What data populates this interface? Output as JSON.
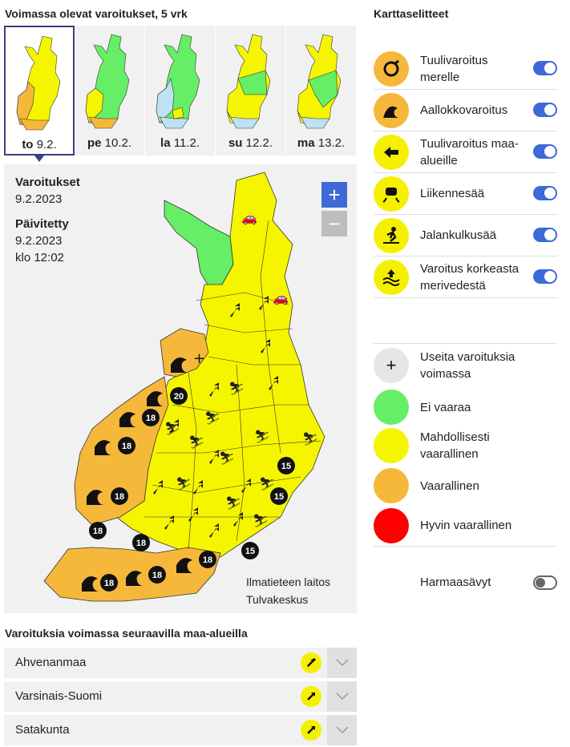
{
  "headings": {
    "days": "Voimassa olevat varoitukset, 5 vrk",
    "legend": "Karttaselitteet",
    "regions": "Varoituksia voimassa seuraavilla maa-alueilla"
  },
  "days": [
    {
      "weekday": "to",
      "date": "9.2.",
      "active": true
    },
    {
      "weekday": "pe",
      "date": "10.2.",
      "active": false
    },
    {
      "weekday": "la",
      "date": "11.2.",
      "active": false
    },
    {
      "weekday": "su",
      "date": "12.2.",
      "active": false
    },
    {
      "weekday": "ma",
      "date": "13.2.",
      "active": false
    }
  ],
  "info": {
    "warnings_label": "Varoitukset",
    "warnings_date": "9.2.2023",
    "updated_label": "Päivitetty",
    "updated_date": "9.2.2023",
    "updated_time": "klo 12:02"
  },
  "zoom": {
    "in": "+",
    "out": "−"
  },
  "credit": {
    "line1": "Ilmatieteen laitos",
    "line2": "Tulvakeskus"
  },
  "map_badges": {
    "sea_wave": [
      "20",
      "18",
      "18",
      "18",
      "18",
      "18",
      "18",
      "18",
      "18"
    ],
    "coast_wave": [
      "15",
      "15",
      "15"
    ]
  },
  "legend": {
    "warnings": [
      {
        "label": "Tuulivaroitus merelle",
        "icon": "sea-wind-icon",
        "color": "#f6b83a",
        "enabled": true
      },
      {
        "label": "Aallokkovaroitus",
        "icon": "wave-icon",
        "color": "#f6b83a",
        "enabled": true
      },
      {
        "label": "Tuulivaroitus maa-alueille",
        "icon": "land-wind-arrow-icon",
        "color": "#f5ef00",
        "enabled": true
      },
      {
        "label": "Liikennesää",
        "icon": "traffic-weather-icon",
        "color": "#f5ef00",
        "enabled": true
      },
      {
        "label": "Jalankulkusää",
        "icon": "pedestrian-weather-icon",
        "color": "#f5ef00",
        "enabled": true
      },
      {
        "label": "Varoitus korkeasta merivedestä",
        "icon": "high-sea-level-icon",
        "color": "#f5ef00",
        "enabled": true
      }
    ],
    "levels": [
      {
        "label": "Useita varoituksia voimassa",
        "color": "#e6e6e6",
        "symbol": "+"
      },
      {
        "label": "Ei vaaraa",
        "color": "#66ee66"
      },
      {
        "label": "Mahdollisesti vaarallinen",
        "color": "#f5f500"
      },
      {
        "label": "Vaarallinen",
        "color": "#f6b83a"
      },
      {
        "label": "Hyvin vaarallinen",
        "color": "#ff0000"
      }
    ],
    "grayscale": {
      "label": "Harmaasävyt",
      "enabled": false
    }
  },
  "regions": [
    {
      "name": "Ahvenanmaa"
    },
    {
      "name": "Varsinais-Suomi"
    },
    {
      "name": "Satakunta"
    }
  ],
  "colors": {
    "green": "#66ee66",
    "yellow": "#f5f500",
    "orange": "#f6b83a",
    "accent": "#3d6ad6",
    "active_border": "#3a3f7e"
  }
}
